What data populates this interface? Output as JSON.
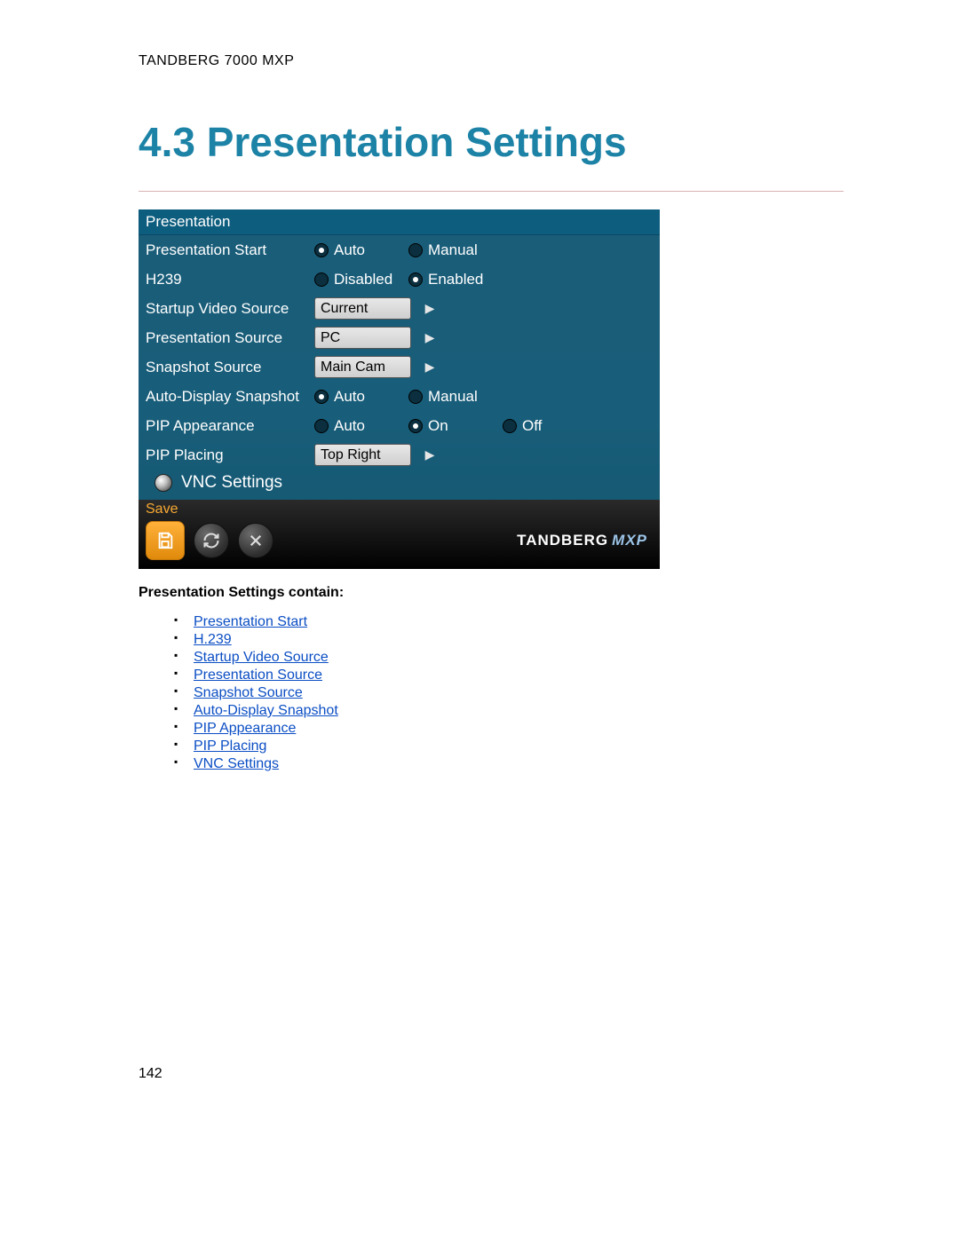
{
  "doc": {
    "product": "TANDBERG 7000 MXP",
    "heading": "4.3 Presentation Settings",
    "subhead": "Presentation Settings contain:",
    "page_number": "142"
  },
  "panel": {
    "title": "Presentation",
    "rows": {
      "presentation_start": {
        "label": "Presentation Start",
        "options": [
          "Auto",
          "Manual"
        ],
        "selected": 0
      },
      "h239": {
        "label": "H239",
        "options": [
          "Disabled",
          "Enabled"
        ],
        "selected": 1
      },
      "startup_video_source": {
        "label": "Startup Video Source",
        "value": "Current"
      },
      "presentation_source": {
        "label": "Presentation Source",
        "value": "PC"
      },
      "snapshot_source": {
        "label": "Snapshot Source",
        "value": "Main Cam"
      },
      "auto_display_snapshot": {
        "label": "Auto-Display Snapshot",
        "options": [
          "Auto",
          "Manual"
        ],
        "selected": 0
      },
      "pip_appearance": {
        "label": "PIP Appearance",
        "options": [
          "Auto",
          "On",
          "Off"
        ],
        "selected": 1
      },
      "pip_placing": {
        "label": "PIP Placing",
        "value": "Top Right"
      }
    },
    "vnc_label": "VNC Settings",
    "save_label": "Save",
    "brand1": "TANDBERG",
    "brand2": "MXP"
  },
  "links": [
    "Presentation Start",
    "H.239",
    "Startup Video Source",
    "Presentation Source",
    "Snapshot Source",
    "Auto-Display Snapshot",
    "PIP Appearance",
    "PIP Placing",
    "VNC Settings"
  ]
}
